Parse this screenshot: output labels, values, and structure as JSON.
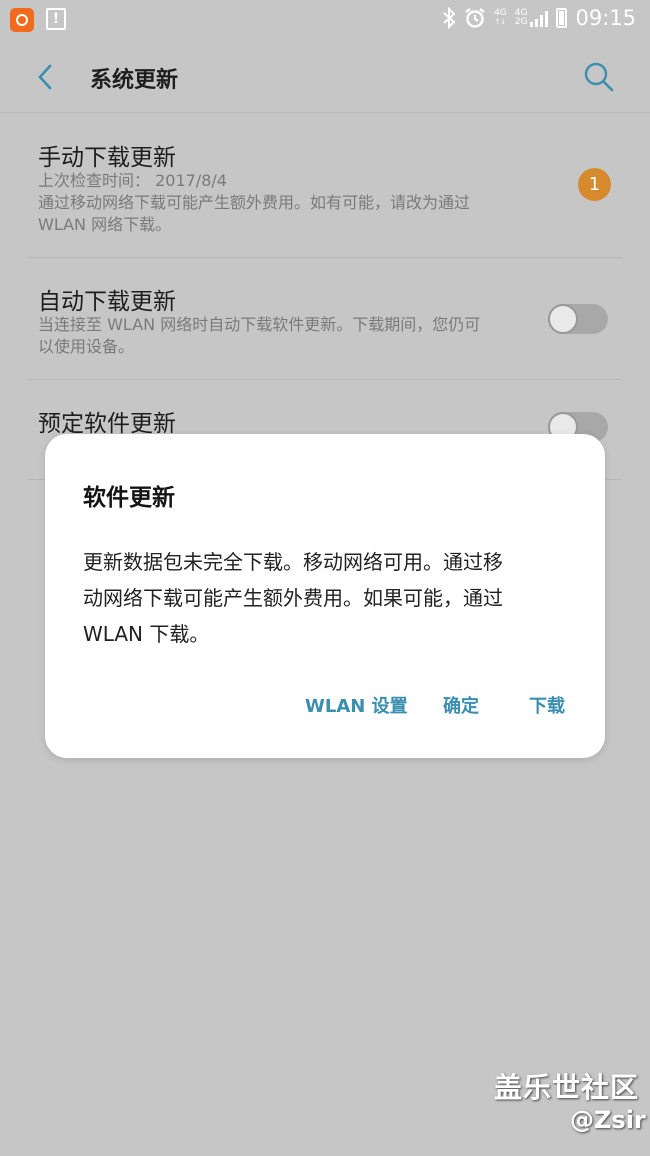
{
  "status_bar": {
    "network_top": "4G",
    "network_sub": "4G",
    "network_2g": "2G",
    "time": "09:15"
  },
  "appbar": {
    "title": "系统更新"
  },
  "settings": [
    {
      "title": "手动下载更新",
      "lines": [
        "上次检查时间： 2017/8/4",
        "通过移动网络下载可能产生额外费用。如有可能，请改为通过",
        "WLAN 网络下载。"
      ],
      "badge": "1"
    },
    {
      "title": "自动下载更新",
      "lines": [
        "当连接至 WLAN 网络时自动下载软件更新。下载期间，您仍可",
        "以使用设备。"
      ],
      "toggle": "off"
    },
    {
      "title": "预定软件更新",
      "toggle": "off"
    }
  ],
  "dialog": {
    "title": "软件更新",
    "message_lines": [
      "更新数据包未完全下载。移动网络可用。通过移",
      "动网络下载可能产生额外费用。如果可能，通过",
      "WLAN 下载。"
    ],
    "buttons": {
      "wlan": "WLAN 设置",
      "ok": "确定",
      "download": "下载"
    }
  },
  "watermark": {
    "site": "盖乐世社区",
    "user": "@Zsir"
  },
  "colors": {
    "accent": "#3a8eb0",
    "badge": "#d78a2d",
    "overlay": "#c6c6c6"
  }
}
